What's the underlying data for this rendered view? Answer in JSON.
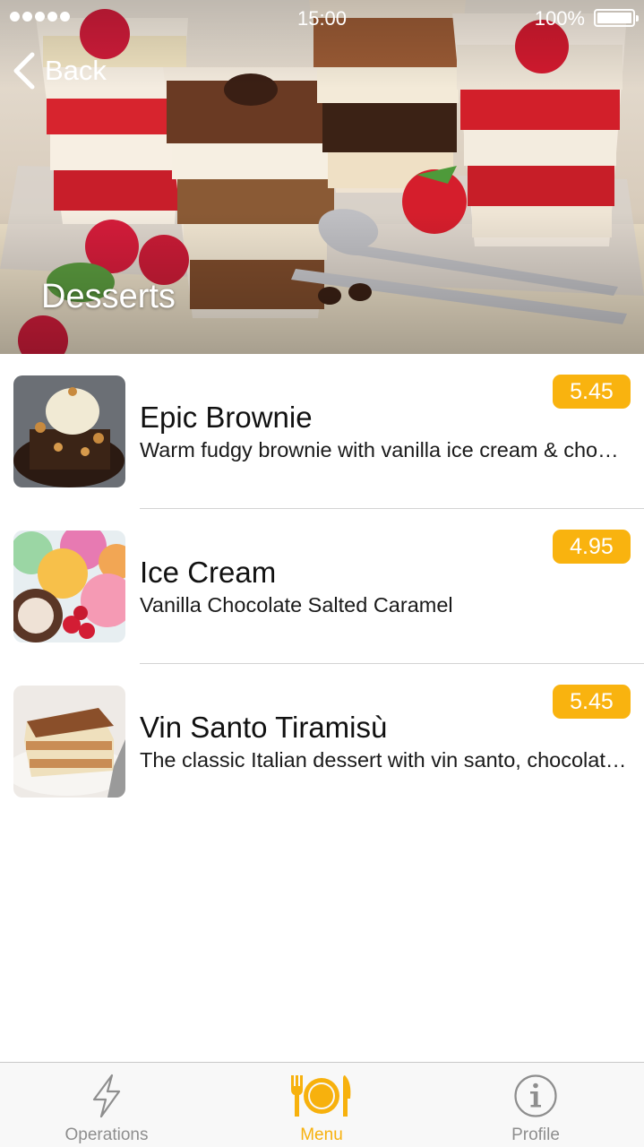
{
  "status_bar": {
    "time": "15:00",
    "battery_percent": "100%"
  },
  "header": {
    "back_label": "Back",
    "title": "Desserts"
  },
  "theme": {
    "accent": "#f9b30f",
    "tab_inactive": "#8e8e8e"
  },
  "items": [
    {
      "name": "Epic Brownie",
      "description": "Warm fudgy brownie with vanilla ice cream & chocolate sauce",
      "price": "5.45"
    },
    {
      "name": "Ice Cream",
      "description": "Vanilla Chocolate Salted Caramel",
      "price": "4.95"
    },
    {
      "name": "Vin Santo Tiramisù",
      "description": "The classic Italian dessert with vin santo, chocolate and mascarpone",
      "price": "5.45"
    }
  ],
  "tabbar": {
    "tabs": [
      {
        "label": "Operations",
        "icon": "lightning-icon",
        "active": false
      },
      {
        "label": "Menu",
        "icon": "plate-cutlery-icon",
        "active": true
      },
      {
        "label": "Profile",
        "icon": "info-icon",
        "active": false
      }
    ]
  }
}
